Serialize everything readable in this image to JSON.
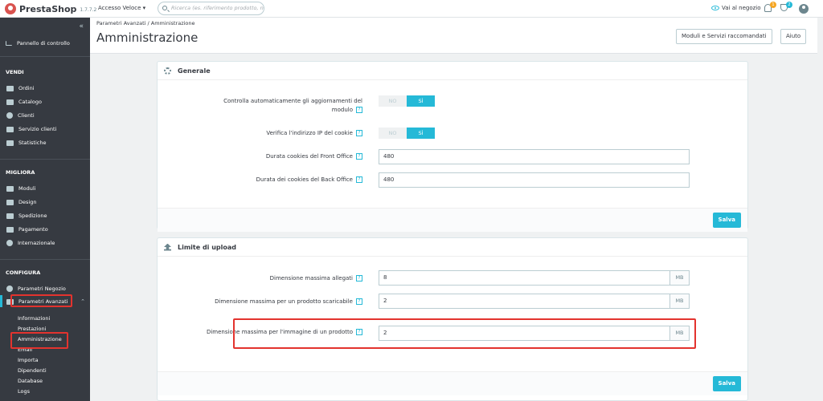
{
  "topbar": {
    "logo_brand": "Presta",
    "logo_brand_2": "Shop",
    "version": "1.7.7.2",
    "quick_access": "Accesso Veloce ▾",
    "search_placeholder": "Ricerca (es. riferimento prodotto, nome",
    "view_shop": "Vai al negozio",
    "notif_count": "1",
    "orders_count": "2"
  },
  "sidebar": {
    "collapse": "«",
    "dashboard": "Pannello di controllo",
    "sections": {
      "vendi": "VENDI",
      "migliora": "MIGLIORA",
      "configura": "CONFIGURA"
    },
    "vendi_items": [
      "Ordini",
      "Catalogo",
      "Clienti",
      "Servizio clienti",
      "Statistiche"
    ],
    "migliora_items": [
      "Moduli",
      "Design",
      "Spedizione",
      "Pagamento",
      "Internazionale"
    ],
    "configura_items": [
      "Parametri Negozio",
      "Parametri Avanzati"
    ],
    "sub_items": [
      "Informazioni",
      "Prestazioni",
      "Amministrazione",
      "Email",
      "Importa",
      "Dipendenti",
      "Database",
      "Logs"
    ]
  },
  "header": {
    "breadcrumb": "Parametri Avanzati  /  Amministrazione",
    "title": "Amministrazione",
    "btn_modules": "Moduli e Servizi raccomandati",
    "btn_help": "Aiuto"
  },
  "general": {
    "title": "Generale",
    "check_updates_label": "Controlla automaticamente gli aggiornamenti del modulo",
    "check_ip_label": "Verifica l'indirizzo IP del cookie",
    "toggle_no": "NO",
    "toggle_si": "SÌ",
    "front_cookie_label": "Durata cookies del Front Office",
    "front_cookie_value": "480",
    "back_cookie_label": "Durata dei cookies del Back Office",
    "back_cookie_value": "480",
    "save": "Salva"
  },
  "upload": {
    "title": "Limite di upload",
    "attach_label": "Dimensione massima allegati",
    "attach_value": "8",
    "download_label": "Dimensione massima per un prodotto scaricabile",
    "download_value": "2",
    "image_label": "Dimensione massima per l'immagine di un prodotto",
    "image_value": "2",
    "unit": "MB",
    "save": "Salva"
  },
  "help_glyph": "?",
  "colors": {
    "accent": "#25b9d7",
    "sidebar": "#363a41",
    "highlight": "#e3332e"
  }
}
